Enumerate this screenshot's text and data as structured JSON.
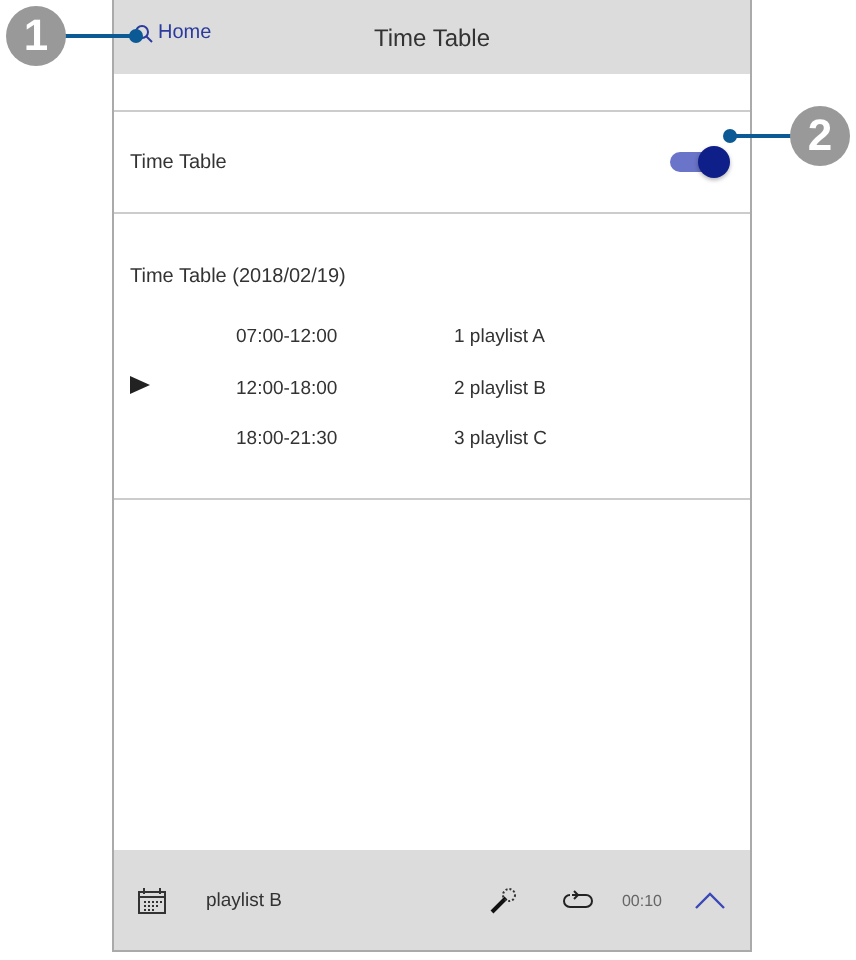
{
  "header": {
    "back_label": "Home",
    "title": "Time Table"
  },
  "setting": {
    "label": "Time Table",
    "on": true
  },
  "schedule": {
    "title": "Time Table (2018/02/19)",
    "rows": [
      {
        "time": "07:00-12:00",
        "playlist": "1 playlist A",
        "playing": false
      },
      {
        "time": "12:00-18:00",
        "playlist": "2 playlist B",
        "playing": true
      },
      {
        "time": "18:00-21:30",
        "playlist": "3 playlist C",
        "playing": false
      }
    ]
  },
  "player_bar": {
    "playlist": "playlist B",
    "time": "00:10"
  },
  "callouts": [
    {
      "number": "1"
    },
    {
      "number": "2"
    }
  ]
}
